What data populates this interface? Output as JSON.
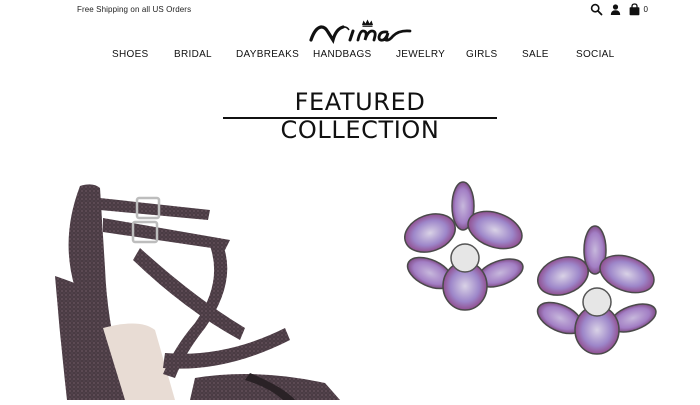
{
  "header": {
    "promo": "Free Shipping on all US Orders",
    "cart_count": "0",
    "icons": [
      "search-icon",
      "account-icon",
      "cart-icon"
    ]
  },
  "logo": {
    "alt": "Nina"
  },
  "nav": {
    "items": [
      {
        "label": "SHOES"
      },
      {
        "label": "BRIDAL"
      },
      {
        "label": "DAYBREAKS"
      },
      {
        "label": "HANDBAGS"
      },
      {
        "label": "JEWELRY"
      },
      {
        "label": "GIRLS"
      },
      {
        "label": "SALE"
      },
      {
        "label": "SOCIAL"
      }
    ]
  },
  "main": {
    "title": "FEATURED COLLECTION"
  },
  "products": [
    {
      "name": "strappy-glitter-heel",
      "accent": "#4b3a42"
    },
    {
      "name": "orchid-crystal-earrings",
      "accent": "#8a3a7a"
    }
  ],
  "colors": {
    "text": "#111111",
    "background": "#ffffff"
  }
}
